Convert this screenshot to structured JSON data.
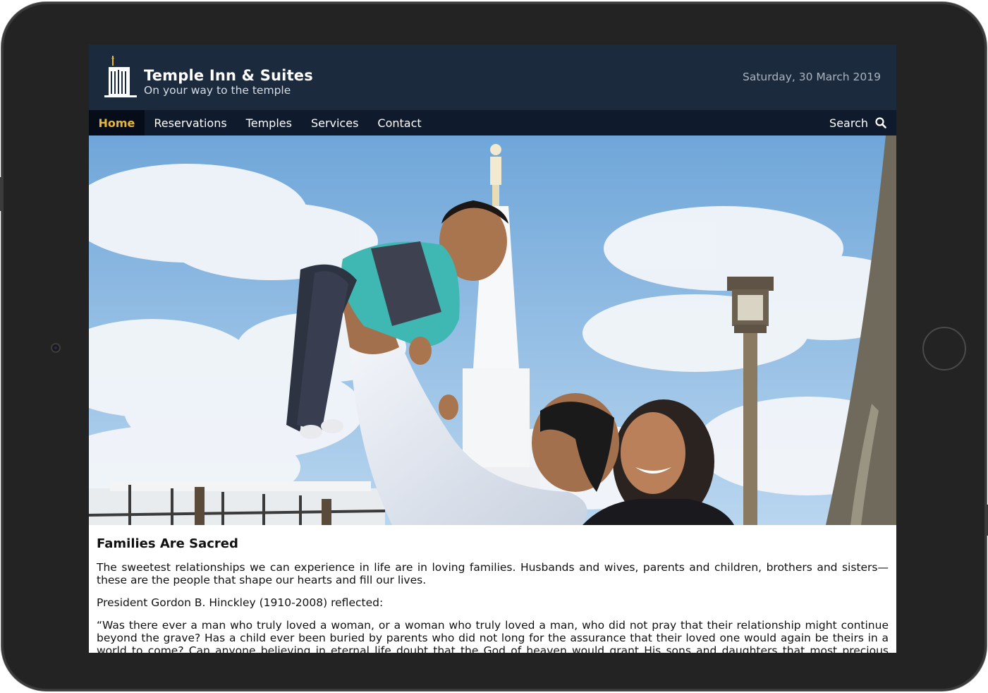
{
  "site": {
    "title": "Temple Inn & Suites",
    "tagline": "On your way to the temple",
    "date": "Saturday, 30 March 2019"
  },
  "nav": {
    "items": [
      {
        "label": "Home",
        "active": true
      },
      {
        "label": "Reservations"
      },
      {
        "label": "Temples"
      },
      {
        "label": "Services"
      },
      {
        "label": "Contact"
      }
    ],
    "search_label": "Search"
  },
  "hero": {
    "icon": "family-photo"
  },
  "article": {
    "heading": "Families Are Sacred",
    "paragraph1": "The sweetest relationships we can experience in life are in loving families. Husbands and wives, parents and children, brothers and sisters—these are the people that shape our hearts and fill our lives.",
    "paragraph2": "President Gordon B. Hinckley (1910-2008) reflected:",
    "paragraph3": "“Was there ever a man who truly loved a woman, or a woman who truly loved a man, who did not pray that their relationship might continue beyond the grave? Has a child ever been buried by parents who did not long for the assurance that their loved one would again be theirs in a world to come? Can anyone believing in eternal life doubt that the God of heaven would grant His sons and daughters that most precious attribute of life, the love that finds its most meaningful expression in family relationships?”"
  },
  "colors": {
    "header_bg": "#1c2a3e",
    "nav_bg": "#0f1a2c",
    "active_nav": "#e8b637",
    "device": "#232323"
  }
}
